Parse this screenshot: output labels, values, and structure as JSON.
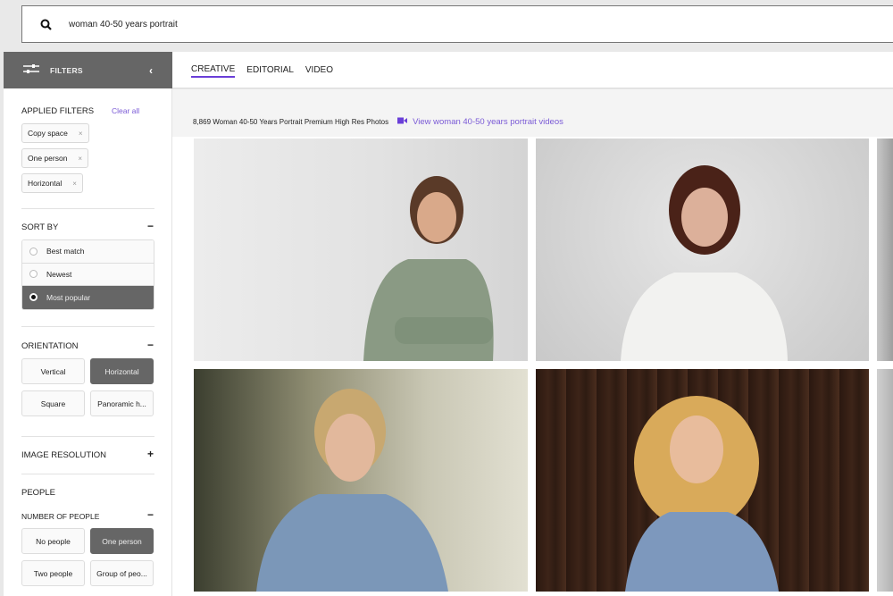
{
  "search": {
    "query": "woman 40-50 years portrait",
    "icon": "search-icon"
  },
  "filters_header": {
    "label": "FILTERS",
    "icon": "sliders-icon",
    "collapse_icon": "chevron-left-icon"
  },
  "tabs": [
    {
      "label": "CREATIVE",
      "active": true
    },
    {
      "label": "EDITORIAL",
      "active": false
    },
    {
      "label": "VIDEO",
      "active": false
    }
  ],
  "applied_filters": {
    "title": "APPLIED FILTERS",
    "clear_label": "Clear all",
    "chips": [
      {
        "label": "Copy space"
      },
      {
        "label": "One person"
      },
      {
        "label": "Horizontal"
      }
    ],
    "remove_glyph": "×"
  },
  "sort_by": {
    "title": "SORT BY",
    "toggle": "−",
    "options": [
      {
        "label": "Best match",
        "selected": false
      },
      {
        "label": "Newest",
        "selected": false
      },
      {
        "label": "Most popular",
        "selected": true
      }
    ]
  },
  "orientation": {
    "title": "ORIENTATION",
    "toggle": "−",
    "options": [
      {
        "label": "Vertical",
        "selected": false
      },
      {
        "label": "Horizontal",
        "selected": true
      },
      {
        "label": "Square",
        "selected": false
      },
      {
        "label": "Panoramic h...",
        "selected": false
      }
    ]
  },
  "image_resolution": {
    "title": "IMAGE RESOLUTION",
    "toggle": "+"
  },
  "people": {
    "title": "PEOPLE",
    "number_title": "NUMBER OF PEOPLE",
    "toggle": "−",
    "options": [
      {
        "label": "No people",
        "selected": false
      },
      {
        "label": "One person",
        "selected": true
      },
      {
        "label": "Two people",
        "selected": false
      },
      {
        "label": "Group of peo...",
        "selected": false
      }
    ]
  },
  "results": {
    "summary": "8,869 Woman 40-50 Years Portrait Premium High Res Photos",
    "video_link": "View woman 40-50 years portrait videos",
    "video_icon": "video-camera-icon"
  },
  "colors": {
    "accent": "#6a3fd8",
    "link": "#7a5ad6",
    "selected_bg": "#666666"
  }
}
